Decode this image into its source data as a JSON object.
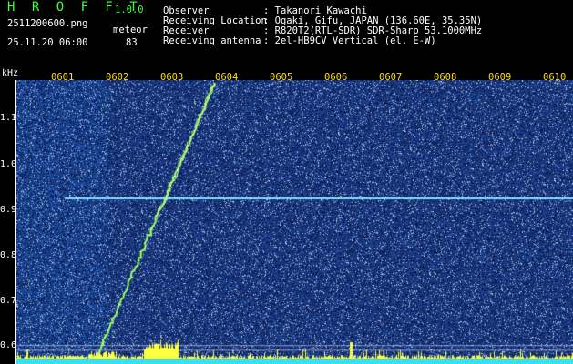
{
  "header": {
    "title": "H R O F F T",
    "version": "1.0.0",
    "filename": "2511200600.png",
    "datetime": "25.11.20 06:00",
    "meteor_label": "meteor",
    "meteor_count": "83",
    "info": [
      {
        "label": "Observer",
        "value": ": Takanori Kawachi"
      },
      {
        "label": "Receiving Location",
        "value": ": Ogaki, Gifu, JAPAN (136.60E, 35.35N)"
      },
      {
        "label": "Receiver",
        "value": ": R820T2(RTL-SDR) SDR-Sharp 53.1000MHz"
      },
      {
        "label": "Receiving antenna",
        "value": ": 2el-HB9CV Vertical (el. E-W)"
      }
    ]
  },
  "colors": {
    "background": "#000000",
    "title_green": "#3cff3c",
    "tick_yellow": "#ffe000",
    "spectrogram_blue": "#1a2a9a",
    "carrier_cyan": "#7fe0ff",
    "meteor_green": "#9cff6a",
    "bottom_cyan": "#38e0f0",
    "bottom_yellow": "#ffff40"
  },
  "axes": {
    "y_unit": "kHz",
    "x_ticks": [
      "0601",
      "0602",
      "0603",
      "0604",
      "0605",
      "0606",
      "0607",
      "0608",
      "0609",
      "0610"
    ],
    "y_ticks": [
      "1.1",
      "1.0",
      "0.9",
      "0.8",
      "0.7",
      "0.6"
    ],
    "y_tick_values": [
      1.1,
      1.0,
      0.9,
      0.8,
      0.7,
      0.6
    ],
    "y_range": [
      0.575,
      1.175
    ],
    "x_range_minutes": [
      0,
      10
    ]
  },
  "carrier_khz": 0.925,
  "meteor_trail": {
    "start_minute": 1.6,
    "start_khz": 0.58,
    "end_minute": 3.8,
    "end_khz": 1.17
  }
}
